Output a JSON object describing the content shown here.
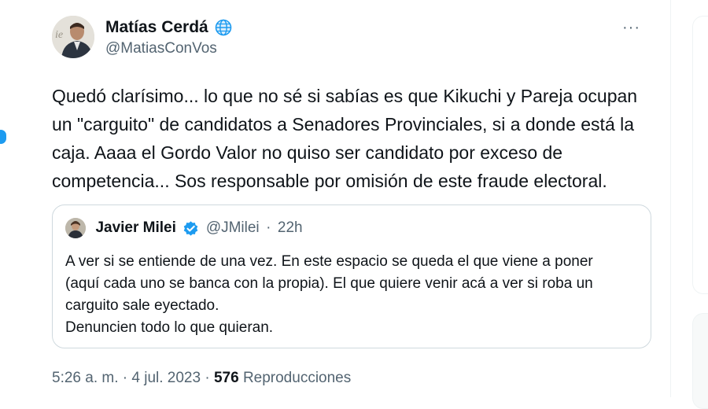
{
  "author": {
    "display_name": "Matías Cerdá",
    "handle": "@MatiasConVos",
    "badge_icon": "globe-icon"
  },
  "tweet": {
    "lines": [
      "Quedó clarísimo... lo que no sé si sabías es que Kikuchi y Pareja ocupan",
      "un \"carguito\" de candidatos a Senadores Provinciales, si a donde está la",
      "caja. Aaaa el Gordo Valor no quiso ser candidato por exceso de",
      "competencia... Sos responsable por omisión de este fraude electoral."
    ]
  },
  "quoted": {
    "display_name": "Javier Milei",
    "handle": "@JMilei",
    "separator": "·",
    "time": "22h",
    "lines": [
      "A ver si se entiende de una vez. En este espacio se queda el que viene a poner",
      "(aquí cada uno se banca con la propia). El que quiere venir acá a ver si roba un",
      "carguito sale eyectado.",
      "Denuncien todo lo que quieran."
    ]
  },
  "meta": {
    "timestamp": "5:26 a. m. · 4 jul. 2023",
    "separator": "·",
    "views_count": "576",
    "views_label": "Reproducciones"
  },
  "more_icon": "···",
  "colors": {
    "accent": "#1d9bf0",
    "text": "#0f1419",
    "secondary": "#536471",
    "border": "#cfd9de"
  }
}
